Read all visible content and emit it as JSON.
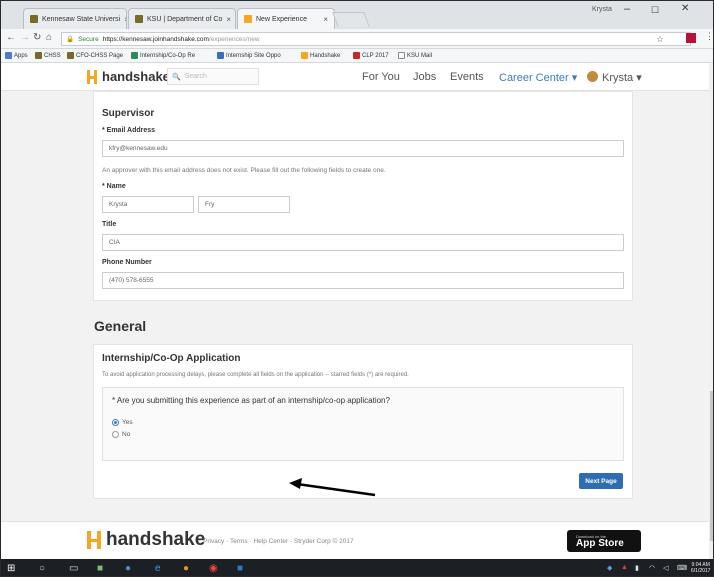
{
  "browser": {
    "tabs": [
      {
        "label": "Kennesaw State Universi",
        "color": "#7a6a2a"
      },
      {
        "label": "KSU | Department of Co",
        "color": "#7a6a2a"
      },
      {
        "label": "New Experience",
        "color": "#f5a623"
      }
    ],
    "window_user": "Krysta",
    "url_secure": "Secure",
    "url_host": "https://kennesaw.joinhandshake.com",
    "url_path": "/experiences/new",
    "bookmarks": [
      "Apps",
      "CHSS",
      "CFO-CHSS Page",
      "Internship/Co-Op Re",
      "Internship Site Oppo",
      "Handshake",
      "CLP 2017",
      "KSU Mail"
    ]
  },
  "nav": {
    "brand": "handshake",
    "search_placeholder": "Search",
    "links": [
      "For You",
      "Jobs",
      "Events"
    ],
    "career_center": "Career Center ▾",
    "user": "Krysta ▾"
  },
  "supervisor": {
    "heading": "Supervisor",
    "email_label": "* Email Address",
    "email_value": "kfry@kennesaw.edu",
    "approver_note": "An approver with this email address does not exist. Please fill out the following fields to create one.",
    "name_label": "* Name",
    "first_name": "Krysta",
    "last_name": "Fry",
    "title_label": "Title",
    "title_value": "CIA",
    "phone_label": "Phone Number",
    "phone_value": "(470) 578-6555"
  },
  "general": {
    "heading": "General",
    "section_title": "Internship/Co-Op Application",
    "note": "To avoid application processing delays, please complete all fields on the application -- starred fields (*) are required.",
    "question": "* Are you submitting this experience as part of an internship/co-op application?",
    "options": [
      "Yes",
      "No"
    ],
    "selected": "Yes",
    "next_label": "Next Page"
  },
  "footer": {
    "brand": "handshake",
    "links": "Privacy · Terms · Help Center · Stryder Corp © 2017",
    "appstore_small": "Download on the",
    "appstore_big": "App Store"
  },
  "taskbar": {
    "time": "9:04 AM",
    "date": "6/1/2017"
  }
}
